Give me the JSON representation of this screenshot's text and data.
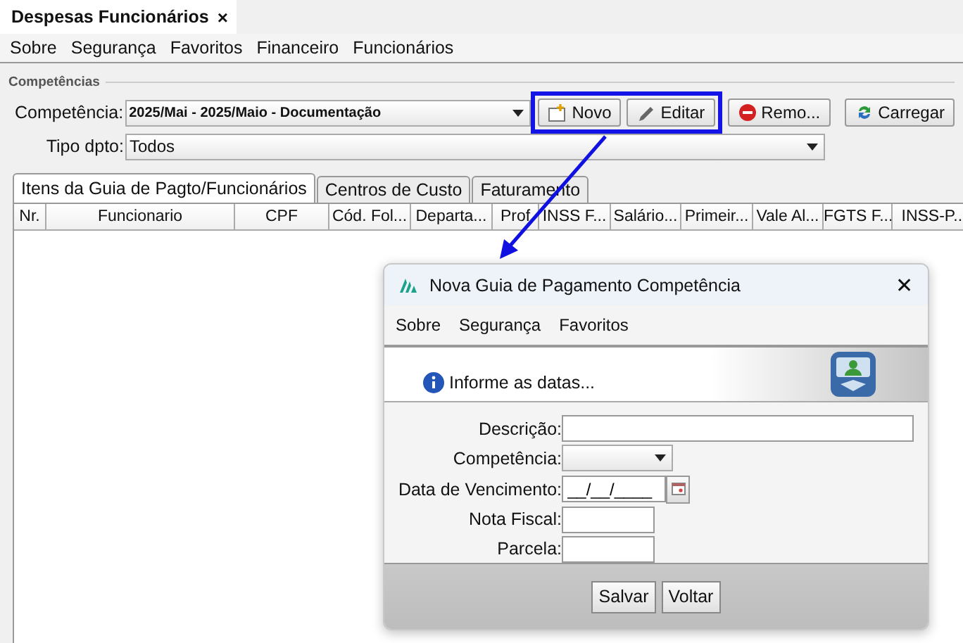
{
  "document_tab": {
    "title": "Despesas Funcionários",
    "close": "×"
  },
  "menu": [
    "Sobre",
    "Segurança",
    "Favoritos",
    "Financeiro",
    "Funcionários"
  ],
  "group": {
    "title": "Competências"
  },
  "competencia": {
    "label": "Competência:",
    "value": "2025/Mai - 2025/Maio - Documentação"
  },
  "buttons": [
    {
      "kind": "new",
      "label": "Novo",
      "highlighted": true
    },
    {
      "kind": "edit",
      "label": "Editar",
      "highlighted": true
    },
    {
      "kind": "remove",
      "label": "Remo...",
      "highlighted": false
    },
    {
      "kind": "load",
      "label": "Carregar",
      "highlighted": false
    }
  ],
  "tipo_dpto": {
    "label": "Tipo dpto:",
    "value": "Todos"
  },
  "tabs": [
    {
      "label": "Itens da Guia de Pagto/Funcionários",
      "selected": true
    },
    {
      "label": "Centros de Custo",
      "selected": false
    },
    {
      "label": "Faturamento",
      "selected": false
    }
  ],
  "table": {
    "columns": [
      "Nr.",
      "Funcionario",
      "CPF",
      "Cód. Fol...",
      "Departa...",
      "Prof",
      "INSS F...",
      "Salário...",
      "Primeir...",
      "Vale Al...",
      "FGTS F...",
      "INSS-P..."
    ]
  },
  "dialog": {
    "title": "Nova Guia de Pagamento Competência",
    "close": "✕",
    "menu": [
      "Sobre",
      "Segurança",
      "Favoritos"
    ],
    "banner": "Informe as datas...",
    "fields": [
      {
        "kind": "line",
        "label": "Descrição:"
      },
      {
        "kind": "combo",
        "label": "Competência:"
      },
      {
        "kind": "date",
        "label": "Data de Vencimento:",
        "value": "__/__/____"
      },
      {
        "kind": "text",
        "label": "Nota Fiscal:"
      },
      {
        "kind": "text",
        "label": "Parcela:"
      }
    ],
    "buttons": [
      "Salvar",
      "Voltar"
    ]
  }
}
